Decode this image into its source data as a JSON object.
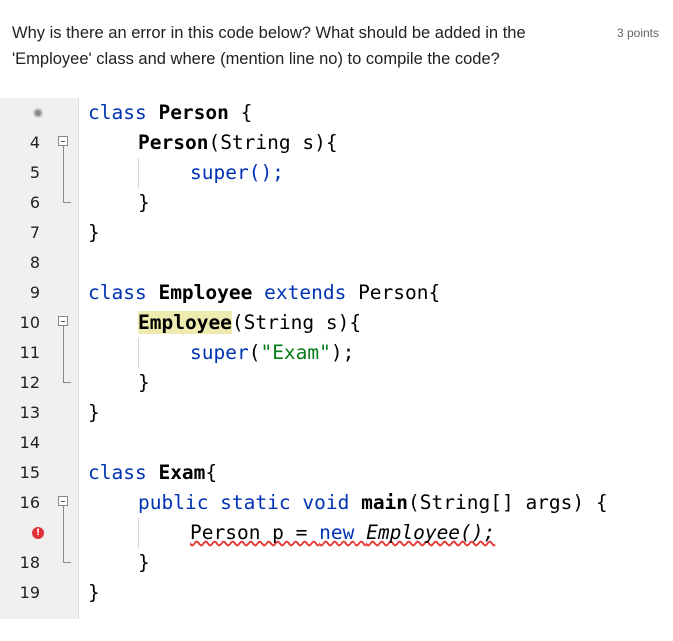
{
  "question": {
    "text": "Why is there an error in this code below? What should be added in the 'Employee' class and where (mention line no) to compile the code?",
    "points": "3 points"
  },
  "editor": {
    "lines": [
      {
        "n": ""
      },
      {
        "n": "4"
      },
      {
        "n": "5"
      },
      {
        "n": "6"
      },
      {
        "n": "7"
      },
      {
        "n": "8"
      },
      {
        "n": "9"
      },
      {
        "n": "10"
      },
      {
        "n": "11"
      },
      {
        "n": "12"
      },
      {
        "n": "13"
      },
      {
        "n": "14"
      },
      {
        "n": "15"
      },
      {
        "n": "16"
      },
      {
        "n": ""
      },
      {
        "n": "18"
      },
      {
        "n": "19"
      }
    ],
    "tokens": {
      "class": "class",
      "person": "Person",
      "open_brace": " {",
      "person_ctor": "Person",
      "string_param": "(String s){",
      "super_call": "super();",
      "close_brace": "}",
      "employee": "Employee",
      "extends": "extends",
      "person_base": "Person{",
      "employee_ctor": "Employee",
      "super_word": "super",
      "exam_str": "\"Exam\"",
      "paren_close": ");",
      "paren_open": "(",
      "exam": "Exam",
      "brace_only": "{",
      "public_static_void": "public static void",
      "main": "main",
      "main_args": "(String[] args) {",
      "person_p": "Person p = ",
      "new_kw": "new",
      "employee_new": "Employee();"
    }
  }
}
